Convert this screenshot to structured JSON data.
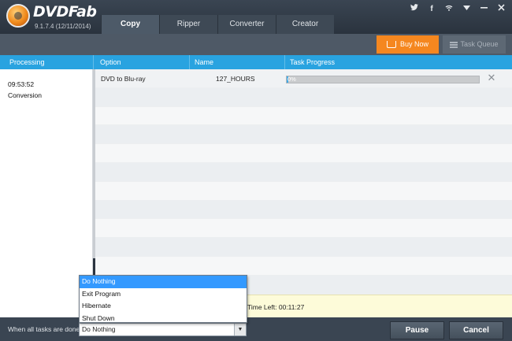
{
  "app": {
    "brand": "DVDFab",
    "version": "9.1.7.4 (12/11/2014)"
  },
  "tabs": [
    {
      "label": "Copy",
      "selected": true
    },
    {
      "label": "Ripper",
      "selected": false
    },
    {
      "label": "Converter",
      "selected": false
    },
    {
      "label": "Creator",
      "selected": false
    }
  ],
  "window_controls": [
    "twitter-icon",
    "facebook-icon",
    "wifi-icon",
    "menu-down-icon",
    "minimize-icon",
    "close-icon"
  ],
  "toolbar": {
    "buy_now": "Buy Now",
    "task_queue": "Task Queue"
  },
  "columns": {
    "processing": "Processing",
    "option": "Option",
    "name": "Name",
    "task_progress": "Task Progress"
  },
  "processing": {
    "time": "09:53:52",
    "label": "Conversion"
  },
  "tasks": [
    {
      "option": "DVD to Blu-ray",
      "name": "127_HOURS",
      "progress_text": "0%",
      "progress": 0.01
    }
  ],
  "status": {
    "time_left": "Time Left: 00:11:27"
  },
  "bottom": {
    "when_done_label": "When all tasks are done:",
    "selected": "Do Nothing",
    "pause": "Pause",
    "cancel": "Cancel"
  },
  "dropdown_options": [
    "Do Nothing",
    "Exit Program",
    "Hibernate",
    "Shut Down"
  ],
  "colors": {
    "accent_blue": "#29a3e0",
    "buy_orange": "#f5871f",
    "selection_blue": "#3399ff"
  }
}
